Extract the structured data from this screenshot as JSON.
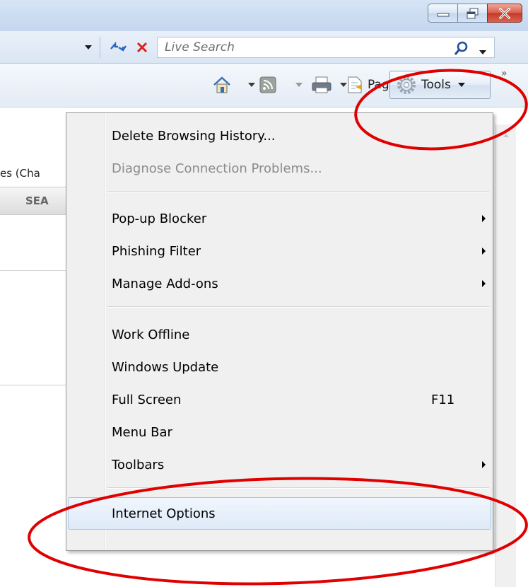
{
  "addressbar": {
    "search_placeholder": "Live Search"
  },
  "commandbar": {
    "page_label": "Page",
    "tools_label": "Tools",
    "overflow_label": "»"
  },
  "page": {
    "clipped_text": "es (Cha",
    "clipped_tab": "SEA"
  },
  "tools_menu": {
    "items": [
      {
        "label": "Delete Browsing History...",
        "enabled": true
      },
      {
        "label": "Diagnose Connection Problems...",
        "enabled": false
      },
      {
        "label": "Pop-up Blocker",
        "submenu": true
      },
      {
        "label": "Phishing Filter",
        "submenu": true
      },
      {
        "label": "Manage Add-ons",
        "submenu": true
      },
      {
        "label": "Work Offline"
      },
      {
        "label": "Windows Update"
      },
      {
        "label": "Full Screen",
        "shortcut": "F11"
      },
      {
        "label": "Menu Bar"
      },
      {
        "label": "Toolbars",
        "submenu": true
      },
      {
        "label": "Internet Options",
        "highlighted": true
      }
    ]
  },
  "colors": {
    "annotation": "#e00000",
    "close_button": "#c5392a",
    "search_icon": "#1f4f9c",
    "stop_icon": "#d8241c"
  }
}
